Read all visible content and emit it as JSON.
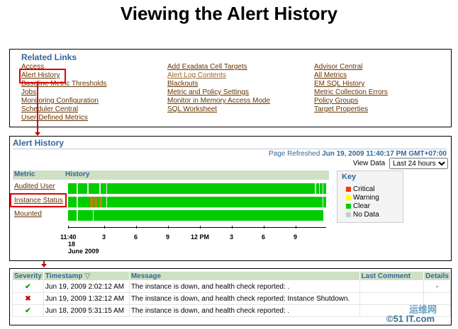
{
  "title": "Viewing the Alert History",
  "related_links": {
    "header": "Related Links",
    "col1": [
      "Access",
      "Alert History",
      "Baseline Metric Thresholds",
      "Jobs",
      "Monitoring Configuration",
      "Scheduler Central",
      "User-Defined Metrics"
    ],
    "col2": [
      "Add Exadata Cell Targets",
      "Alert Log Contents",
      "Blackouts",
      "Metric and Policy Settings",
      "Monitor in Memory Access Mode",
      "SQL Worksheet"
    ],
    "col3": [
      "Advisor Central",
      "All Metrics",
      "EM SQL History",
      "Metric Collection Errors",
      "Policy Groups",
      "Target Properties"
    ]
  },
  "alert_history": {
    "header": "Alert History",
    "page_refreshed_label": "Page Refreshed",
    "page_refreshed_value": "Jun 19, 2009 11:40:17 PM GMT+07:00",
    "view_data_label": "View Data",
    "view_data_value": "Last 24 hours",
    "metric_col": "Metric",
    "history_col": "History",
    "metrics": [
      "Audited User",
      "Instance Status",
      "Mounted"
    ],
    "axis_labels": [
      "11:40",
      "3",
      "6",
      "9",
      "12 PM",
      "3",
      "6",
      "9"
    ],
    "axis_date_line1": "18",
    "axis_date_line2": "June 2009",
    "key": {
      "header": "Key",
      "items": [
        {
          "label": "Critical",
          "color": "#ff3300"
        },
        {
          "label": "Warning",
          "color": "#ffff00"
        },
        {
          "label": "Clear",
          "color": "#00cc00"
        },
        {
          "label": "No Data",
          "color": "#cccccc"
        }
      ]
    }
  },
  "alerts_table": {
    "columns": [
      "Severity",
      "Timestamp",
      "Message",
      "Last Comment",
      "Details"
    ],
    "rows": [
      {
        "severity": "clear",
        "severity_symbol": "✔",
        "timestamp": "Jun 19, 2009 2:02:12 AM",
        "message": "The instance is down, and health check reported: .",
        "last_comment": "",
        "details": "-"
      },
      {
        "severity": "critical",
        "severity_symbol": "✖",
        "timestamp": "Jun 19, 2009 1:32:12 AM",
        "message": "The instance is down, and health check reported: Instance Shutdown.",
        "last_comment": "",
        "details": ""
      },
      {
        "severity": "clear",
        "severity_symbol": "✔",
        "timestamp": "Jun 18, 2009 5:31:15 AM",
        "message": "The instance is down, and health check reported: .",
        "last_comment": "",
        "details": ""
      }
    ]
  },
  "watermark": {
    "line1": "运维网",
    "line2": "©51 IT.com"
  }
}
